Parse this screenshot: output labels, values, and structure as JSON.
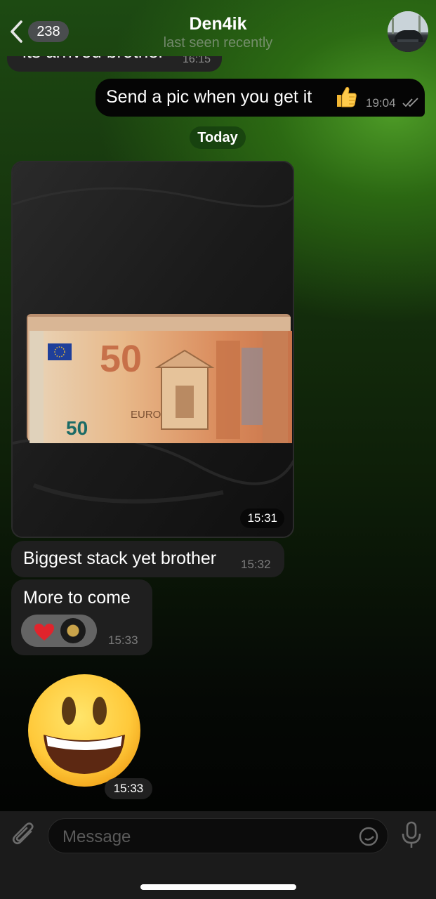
{
  "header": {
    "back_count": "238",
    "title": "Den4ik",
    "status": "last seen recently"
  },
  "messages": {
    "cut_previous": {
      "text": "its arrived brother",
      "time": "16:15"
    },
    "outgoing": {
      "text": "Send a pic when you get it",
      "emoji": "thumbs-up-icon",
      "time": "19:04"
    },
    "date_separator": "Today",
    "photo": {
      "time": "15:31",
      "alt": "stack of 50 euro banknotes"
    },
    "text1": {
      "text": "Biggest stack yet brother",
      "time": "15:32"
    },
    "text2": {
      "text": "More to come",
      "time": "15:33",
      "reaction": "red-heart"
    },
    "big_emoji": {
      "emoji": "grinning-face",
      "time": "15:33"
    }
  },
  "input": {
    "placeholder": "Message"
  },
  "colors": {
    "accent_green": "#2f7a1a",
    "bubble_incoming": "#1f1f1f",
    "bubble_outgoing": "#050505"
  }
}
